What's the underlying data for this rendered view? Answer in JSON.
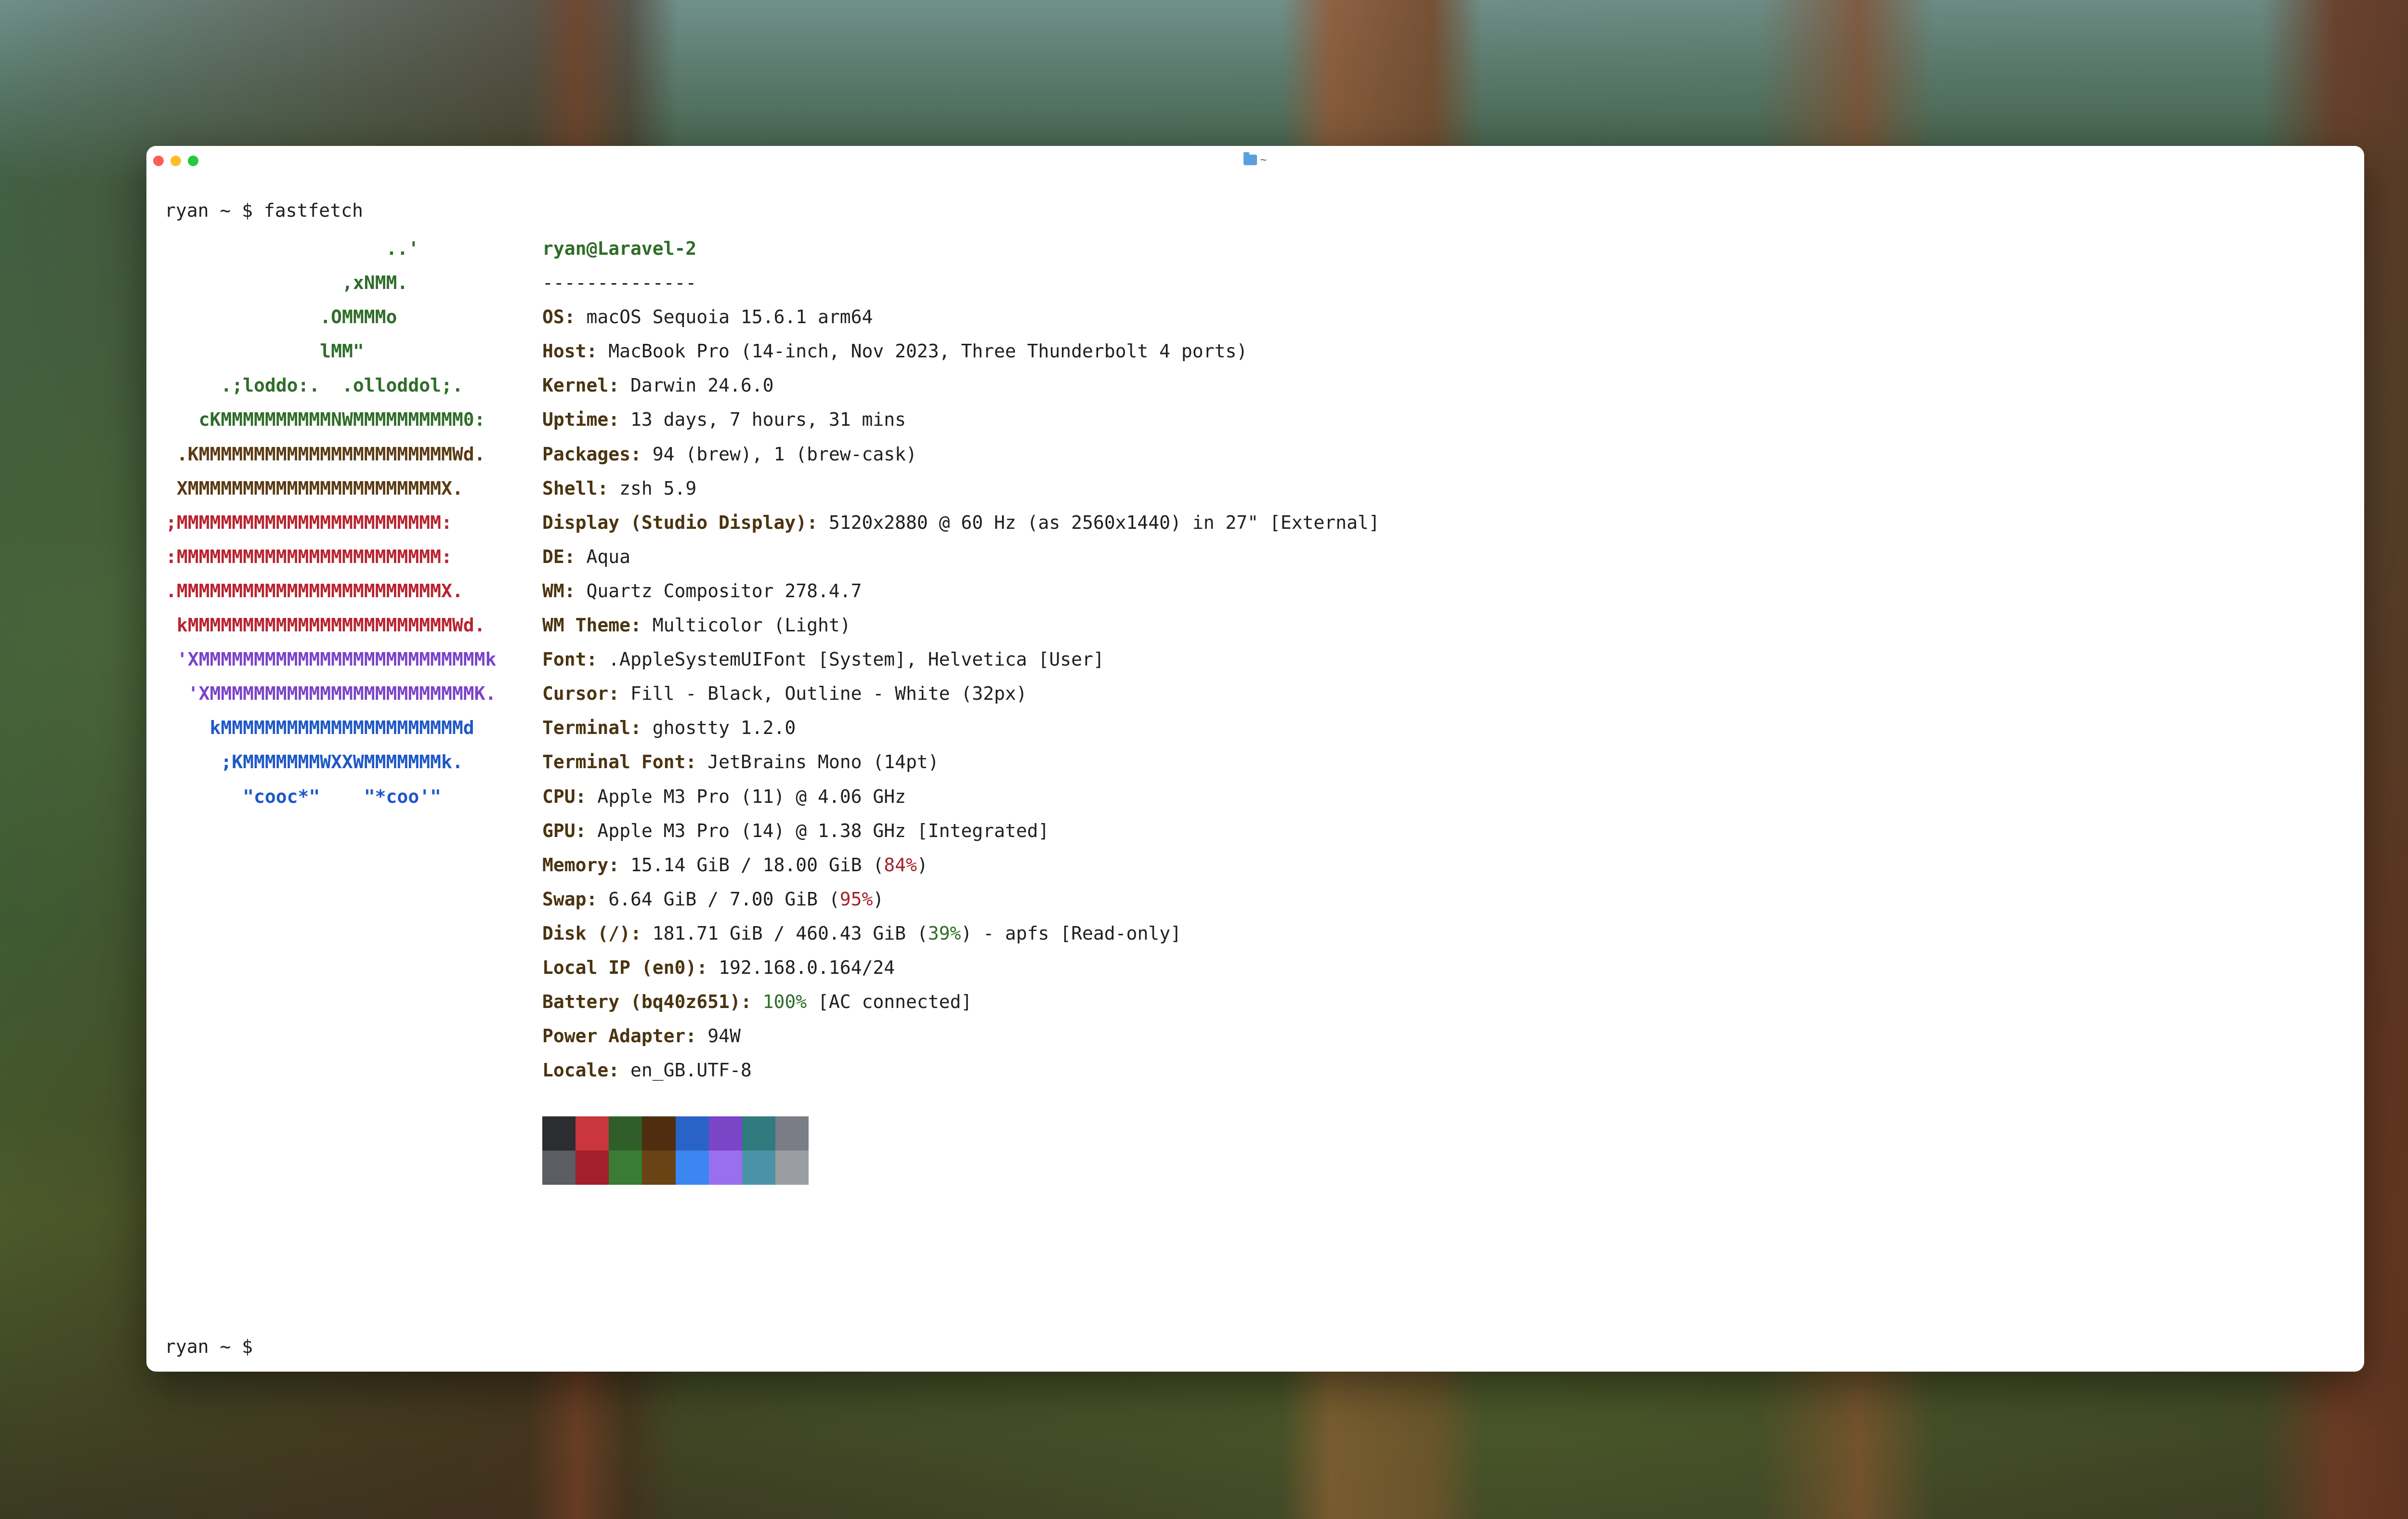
{
  "window": {
    "title": "~",
    "controls": [
      "close",
      "minimize",
      "zoom"
    ]
  },
  "terminal": {
    "prompt": "ryan ~ $",
    "command": "fastfetch",
    "logo_lines": [
      {
        "text": "                    ..'",
        "color": "green"
      },
      {
        "text": "                ,xNMM.",
        "color": "green"
      },
      {
        "text": "              .OMMMMo",
        "color": "green"
      },
      {
        "text": "              lMM\"",
        "color": "green"
      },
      {
        "text": "     .;loddo:.  .olloddol;.",
        "color": "green"
      },
      {
        "text": "   cKMMMMMMMMMMNWMMMMMMMMMM0:",
        "color": "green"
      },
      {
        "text": " .KMMMMMMMMMMMMMMMMMMMMMMMWd.",
        "color": "yellow"
      },
      {
        "text": " XMMMMMMMMMMMMMMMMMMMMMMMX.",
        "color": "yellow"
      },
      {
        "text": ";MMMMMMMMMMMMMMMMMMMMMMMM:",
        "color": "red"
      },
      {
        "text": ":MMMMMMMMMMMMMMMMMMMMMMMM:",
        "color": "red"
      },
      {
        "text": ".MMMMMMMMMMMMMMMMMMMMMMMMX.",
        "color": "red"
      },
      {
        "text": " kMMMMMMMMMMMMMMMMMMMMMMMMWd.",
        "color": "red"
      },
      {
        "text": " 'XMMMMMMMMMMMMMMMMMMMMMMMMMMk",
        "color": "purple"
      },
      {
        "text": "  'XMMMMMMMMMMMMMMMMMMMMMMMMK.",
        "color": "purple"
      },
      {
        "text": "    kMMMMMMMMMMMMMMMMMMMMMMd",
        "color": "blue"
      },
      {
        "text": "     ;KMMMMMMMWXXWMMMMMMMk.",
        "color": "blue"
      },
      {
        "text": "       \"cooc*\"    \"*coo'\"",
        "color": "blue"
      }
    ],
    "info": {
      "userhost": "ryan@Laravel-2",
      "separator": "--------------",
      "rows": [
        {
          "key": "OS",
          "value": "macOS Sequoia 15.6.1 arm64"
        },
        {
          "key": "Host",
          "value": "MacBook Pro (14-inch, Nov 2023, Three Thunderbolt 4 ports)"
        },
        {
          "key": "Kernel",
          "value": "Darwin 24.6.0"
        },
        {
          "key": "Uptime",
          "value": "13 days, 7 hours, 31 mins"
        },
        {
          "key": "Packages",
          "value": "94 (brew), 1 (brew-cask)"
        },
        {
          "key": "Shell",
          "value": "zsh 5.9"
        },
        {
          "key": "Display (Studio Display)",
          "value": "5120x2880 @ 60 Hz (as 2560x1440) in 27\" [External]"
        },
        {
          "key": "DE",
          "value": "Aqua"
        },
        {
          "key": "WM",
          "value": "Quartz Compositor 278.4.7"
        },
        {
          "key": "WM Theme",
          "value": "Multicolor (Light)"
        },
        {
          "key": "Font",
          "value": ".AppleSystemUIFont [System], Helvetica [User]"
        },
        {
          "key": "Cursor",
          "value": "Fill - Black, Outline - White (32px)"
        },
        {
          "key": "Terminal",
          "value": "ghostty 1.2.0"
        },
        {
          "key": "Terminal Font",
          "value": "JetBrains Mono (14pt)"
        },
        {
          "key": "CPU",
          "value": "Apple M3 Pro (11) @ 4.06 GHz"
        },
        {
          "key": "GPU",
          "value": "Apple M3 Pro (14) @ 1.38 GHz [Integrated]"
        },
        {
          "key": "Memory",
          "value_pre": "15.14 GiB / 18.00 GiB (",
          "pct": "84%",
          "pct_color": "red",
          "value_post": ")"
        },
        {
          "key": "Swap",
          "value_pre": "6.64 GiB / 7.00 GiB (",
          "pct": "95%",
          "pct_color": "red",
          "value_post": ")"
        },
        {
          "key": "Disk (/)",
          "value_pre": "181.71 GiB / 460.43 GiB (",
          "pct": "39%",
          "pct_color": "green",
          "value_post": ") - apfs [Read-only]"
        },
        {
          "key": "Local IP (en0)",
          "value": "192.168.0.164/24"
        },
        {
          "key": "Battery (bq40z651)",
          "value_pre": "",
          "pct": "100%",
          "pct_color": "green",
          "value_post": " [AC connected]"
        },
        {
          "key": "Power Adapter",
          "value": "94W"
        },
        {
          "key": "Locale",
          "value": "en_GB.UTF-8"
        }
      ]
    },
    "palette_top": [
      "#2b2d31",
      "#c9363e",
      "#2f5e2a",
      "#4e2e0f",
      "#2a63c8",
      "#7b45c8",
      "#2f7b7e",
      "#7a7d85"
    ],
    "palette_bottom": [
      "#5a5d64",
      "#a21f2b",
      "#3a7c33",
      "#6a4314",
      "#3b86f0",
      "#9b6ef0",
      "#4a93a6",
      "#9a9da3"
    ]
  },
  "colors": {
    "green": "#2f6d2a",
    "yellow": "#5a3a12",
    "red": "#b8232f",
    "purple": "#7a43c9",
    "blue": "#1e58c7"
  }
}
